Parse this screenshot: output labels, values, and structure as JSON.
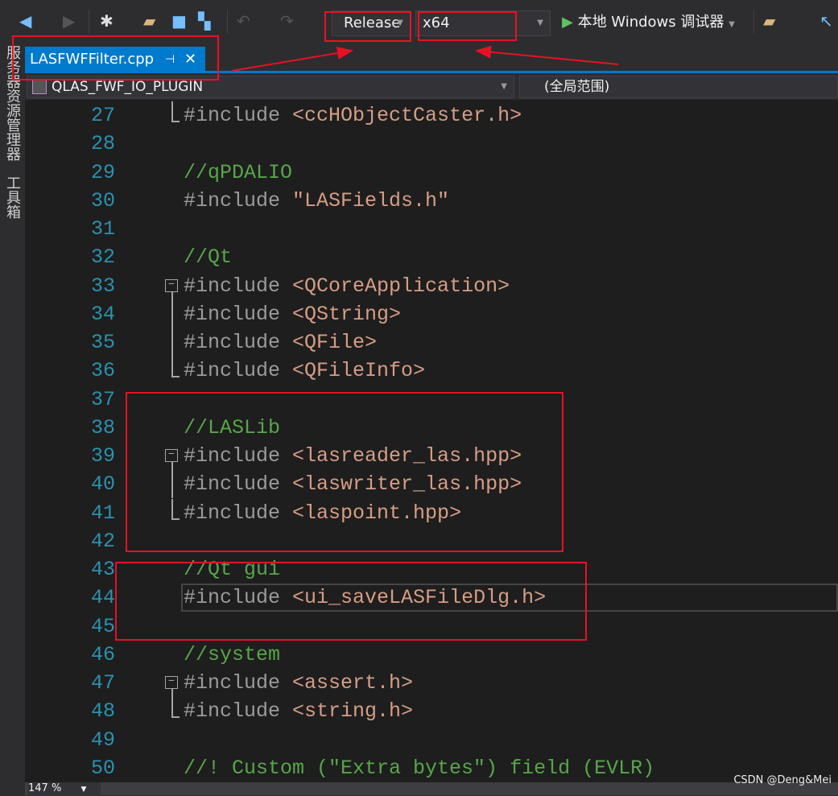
{
  "toolbar": {
    "icons": [
      "back-icon",
      "forward-icon",
      "new-project-icon",
      "open-file-icon",
      "save-icon",
      "save-all-icon",
      "undo-icon",
      "redo-icon"
    ],
    "configuration": "Release",
    "platform": "x64",
    "debugger": "本地 Windows 调试器"
  },
  "sidebar": {
    "items": [
      "服务器资源管理器",
      "工具箱"
    ]
  },
  "tab": {
    "label": "LASFWFFilter.cpp"
  },
  "nav": {
    "scope_left": "QLAS_FWF_IO_PLUGIN",
    "scope_right": "(全局范围)"
  },
  "code": [
    {
      "n": "27",
      "pp": "#include ",
      "s": "<ccHObjectCaster.h>",
      "guide": "end"
    },
    {
      "n": "28"
    },
    {
      "n": "29",
      "c": "//qPDALIO"
    },
    {
      "n": "30",
      "pp": "#include ",
      "s": "\"LASFields.h\""
    },
    {
      "n": "31"
    },
    {
      "n": "32",
      "c": "//Qt"
    },
    {
      "n": "33",
      "pp": "#include ",
      "s": "<QCoreApplication>",
      "guide": "fold"
    },
    {
      "n": "34",
      "pp": "#include ",
      "s": "<QString>",
      "guide": "mid"
    },
    {
      "n": "35",
      "pp": "#include ",
      "s": "<QFile>",
      "guide": "mid"
    },
    {
      "n": "36",
      "pp": "#include ",
      "s": "<QFileInfo>",
      "guide": "end"
    },
    {
      "n": "37"
    },
    {
      "n": "38",
      "c": "//LASLib"
    },
    {
      "n": "39",
      "pp": "#include ",
      "s": "<lasreader_las.hpp>",
      "guide": "fold"
    },
    {
      "n": "40",
      "pp": "#include ",
      "s": "<laswriter_las.hpp>",
      "guide": "mid"
    },
    {
      "n": "41",
      "pp": "#include ",
      "s": "<laspoint.hpp>",
      "guide": "end"
    },
    {
      "n": "42"
    },
    {
      "n": "43",
      "c": "//Qt gui"
    },
    {
      "n": "44",
      "pp": "#include ",
      "s": "<ui_saveLASFileDlg.h>",
      "current": true
    },
    {
      "n": "45"
    },
    {
      "n": "46",
      "c": "//system"
    },
    {
      "n": "47",
      "pp": "#include ",
      "s": "<assert.h>",
      "guide": "fold"
    },
    {
      "n": "48",
      "pp": "#include ",
      "s": "<string.h>",
      "guide": "end"
    },
    {
      "n": "49"
    },
    {
      "n": "50",
      "c": "//! Custom (\"Extra bytes\") field (EVLR)"
    }
  ],
  "status": {
    "zoom": "147 %"
  },
  "watermark": "CSDN @Deng&Mei",
  "colors": {
    "accent": "#007acc",
    "annotation": "#e81123",
    "comment": "#57a64a",
    "string": "#d69d85",
    "line_number": "#2b91af"
  }
}
